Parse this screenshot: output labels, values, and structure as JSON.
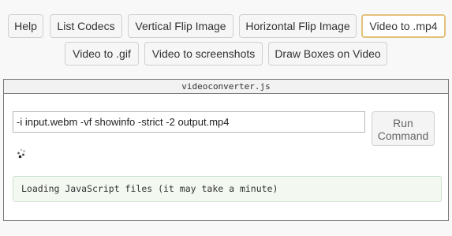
{
  "toolbar": {
    "row1": [
      "Help",
      "List Codecs",
      "Vertical Flip Image",
      "Horizontal Flip Image",
      "Video to .mp4"
    ],
    "row2": [
      "Video to .gif",
      "Video to screenshots",
      "Draw Boxes on Video"
    ],
    "active": "Video to .mp4"
  },
  "panel": {
    "title": "videoconverter.js",
    "command_value": "-i input.webm -vf showinfo -strict -2 output.mp4",
    "run_label_line1": "Run",
    "run_label_line2": "Command",
    "status": "Loading JavaScript files (it may take a minute)"
  },
  "colors": {
    "active_border": "#e3c27a",
    "status_bg": "#f3f8f1",
    "status_border": "#cfe3cf"
  }
}
